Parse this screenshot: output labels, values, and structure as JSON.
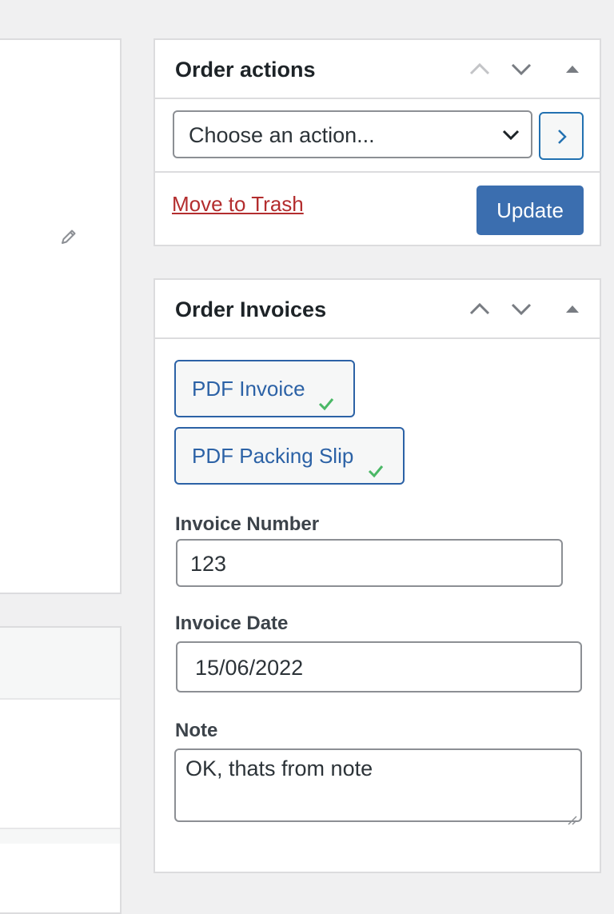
{
  "order_actions": {
    "title": "Order actions",
    "select_value": "Choose an action...",
    "trash_label": "Move to Trash",
    "update_label": "Update"
  },
  "order_invoices": {
    "title": "Order Invoices",
    "documents": [
      {
        "label": "PDF Invoice",
        "status_icon": "check-icon"
      },
      {
        "label": "PDF Packing Slip",
        "status_icon": "check-icon"
      }
    ],
    "invoice_number_label": "Invoice Number",
    "invoice_number_value": "123",
    "invoice_date_label": "Invoice Date",
    "invoice_date_value": "15/06/2022",
    "note_label": "Note",
    "note_value": "OK, thats from note"
  },
  "colors": {
    "background": "#f0f0f1",
    "primary_button": "#3b6eaf",
    "link_primary": "#2c62a6",
    "trash_link": "#b32d2e",
    "check_green": "#4ab866"
  },
  "icons": {
    "header_controls": [
      "move-up-icon",
      "move-down-icon",
      "collapse-toggle-icon"
    ],
    "left_panel": "pencil-icon"
  }
}
